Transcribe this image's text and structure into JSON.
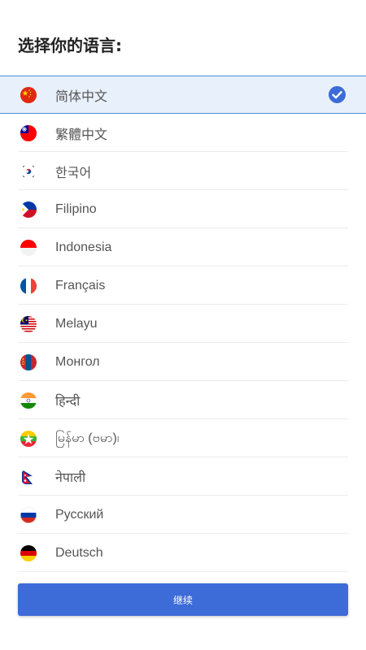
{
  "page": {
    "title": "选择你的语言:"
  },
  "languages": [
    {
      "label": "简体中文",
      "flag": "china-flag-icon",
      "selected": true
    },
    {
      "label": "繁體中文",
      "flag": "taiwan-flag-icon",
      "selected": false
    },
    {
      "label": "한국어",
      "flag": "south-korea-flag-icon",
      "selected": false
    },
    {
      "label": "Filipino",
      "flag": "philippines-flag-icon",
      "selected": false
    },
    {
      "label": "Indonesia",
      "flag": "indonesia-flag-icon",
      "selected": false
    },
    {
      "label": "Français",
      "flag": "france-flag-icon",
      "selected": false
    },
    {
      "label": "Melayu",
      "flag": "malaysia-flag-icon",
      "selected": false
    },
    {
      "label": "Монгол",
      "flag": "mongolia-flag-icon",
      "selected": false
    },
    {
      "label": "हिन्दी",
      "flag": "india-flag-icon",
      "selected": false
    },
    {
      "label": "မြန်မာ (ဗမာ)၊",
      "flag": "myanmar-flag-icon",
      "selected": false
    },
    {
      "label": "नेपाली",
      "flag": "nepal-flag-icon",
      "selected": false
    },
    {
      "label": "Русский",
      "flag": "russia-flag-icon",
      "selected": false
    },
    {
      "label": "Deutsch",
      "flag": "germany-flag-icon",
      "selected": false
    }
  ],
  "footer": {
    "continue_label": "继续"
  },
  "colors": {
    "accent": "#3d6bd8",
    "selected_background": "#e8f0fb",
    "selected_border": "#4a90d9",
    "check": "#3d6bd8"
  }
}
